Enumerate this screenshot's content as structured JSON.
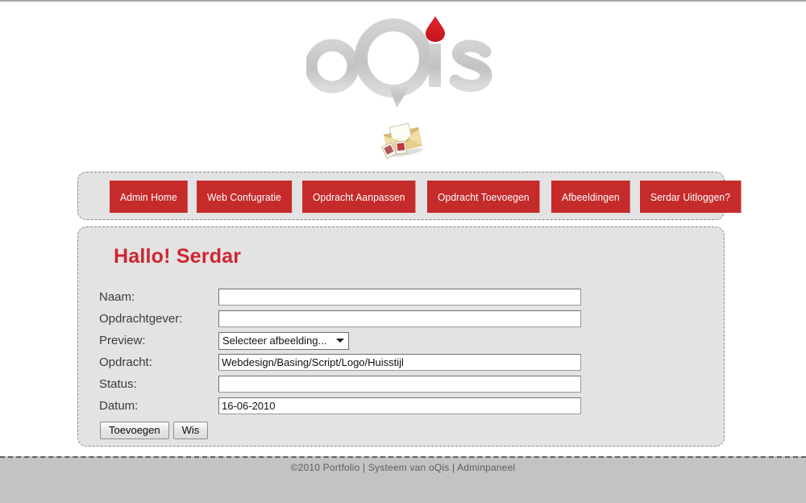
{
  "brand": {
    "logo_text": "oQis",
    "logo_gray": "#c6c6c6",
    "logo_accent": "#d41f26",
    "icon_name": "envelope-photos-icon"
  },
  "nav": {
    "items": [
      {
        "label": "Admin Home"
      },
      {
        "label": "Web Confugratie"
      },
      {
        "label": "Opdracht Aanpassen"
      },
      {
        "label": "Opdracht Toevoegen"
      },
      {
        "label": "Afbeeldingen"
      },
      {
        "label": "Serdar Uitloggen?"
      }
    ],
    "button_color": "#c62b2b",
    "button_text_color": "#ffffff"
  },
  "content": {
    "greeting": "Hallo! Serdar",
    "greeting_color": "#cf2531",
    "form": {
      "rows": [
        {
          "label": "Naam:",
          "type": "text",
          "value": "",
          "placeholder": ""
        },
        {
          "label": "Opdrachtgever:",
          "type": "text",
          "value": "",
          "placeholder": ""
        },
        {
          "label": "Preview:",
          "type": "select",
          "value": "Selecteer afbeelding...",
          "options": [
            "Selecteer afbeelding..."
          ]
        },
        {
          "label": "Opdracht:",
          "type": "text",
          "value": "Webdesign/Basing/Script/Logo/Huisstijl",
          "placeholder": ""
        },
        {
          "label": "Status:",
          "type": "text",
          "value": "",
          "placeholder": ""
        },
        {
          "label": "Datum:",
          "type": "text",
          "value": "16-06-2010",
          "placeholder": ""
        }
      ],
      "submit_label": "Toevoegen",
      "reset_label": "Wis"
    }
  },
  "footer": {
    "text": "©2010 Portfolio | Systeem van oQis | Adminpaneel"
  }
}
